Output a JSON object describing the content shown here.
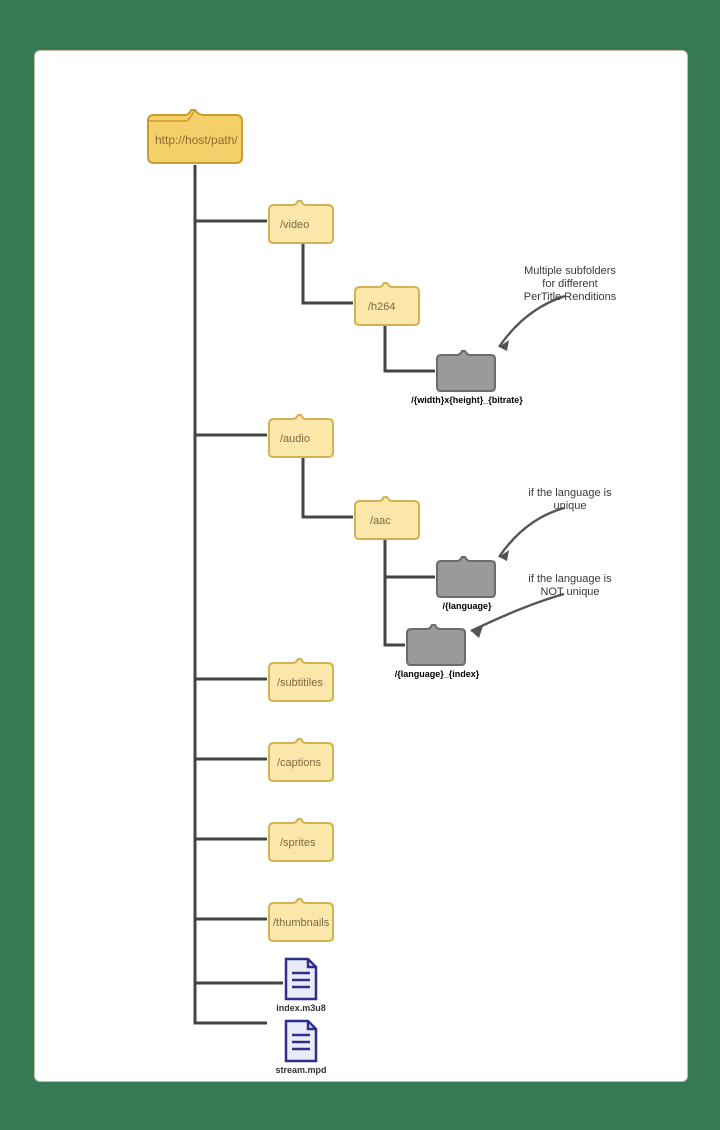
{
  "root": {
    "label": "http://host/path/"
  },
  "video": {
    "label": "/video"
  },
  "h264": {
    "label": "/h264"
  },
  "videorend": {
    "label": "/{width}x{height}_{bitrate}"
  },
  "videonote": {
    "line1": "Multiple subfolders",
    "line2": "for different",
    "line3": "PerTitle Renditions"
  },
  "audio": {
    "label": "/audio"
  },
  "aac": {
    "label": "/aac"
  },
  "audlang": {
    "label": "/{language}"
  },
  "audlangidx": {
    "label": "/{language}_{index}"
  },
  "audnote1": {
    "line1": "if the language is",
    "line2": "unique"
  },
  "audnote2": {
    "line1": "if the language is",
    "line2": "NOT unique"
  },
  "subtitles": {
    "label": "/subtitiles"
  },
  "captions": {
    "label": "/captions"
  },
  "sprites": {
    "label": "/sprites"
  },
  "thumbnails": {
    "label": "/thumbnails"
  },
  "indexfile": {
    "label": "index.m3u8"
  },
  "streamfile": {
    "label": "stream.mpd"
  }
}
